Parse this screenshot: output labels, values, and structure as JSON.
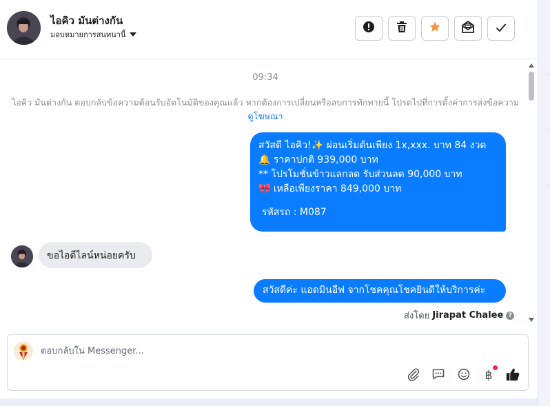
{
  "header": {
    "contact_name": "ไอคิว มันต่างกัน",
    "assign_label": "มอบหมายการสนทนานี้",
    "actions": [
      {
        "name": "report-spam",
        "icon": "alert-circle-icon"
      },
      {
        "name": "delete",
        "icon": "trash-icon"
      },
      {
        "name": "star",
        "icon": "star-icon",
        "color": "#f7923a"
      },
      {
        "name": "mark-unread",
        "icon": "envelope-icon"
      },
      {
        "name": "mark-done",
        "icon": "check-icon"
      }
    ]
  },
  "conversation": {
    "timestamp": "09:34",
    "system_message": "ไอคิว มันต่างกัน ตอบกลับข้อความต้อนรับอัตโนมัติของคุณแล้ว หากต้องการเปลี่ยนหรือลบการทักทายนี้ โปรดไปที่การตั้งค่าการส่งข้อความ",
    "system_link": "ดูโฆษณา",
    "outgoing_1": {
      "lines": [
        "สวัสดี ไอคิว!✨  ผ่อนเริ่มต้นเพียง 1x,xxx. บาท 84 งวด",
        "🔔 ราคาปกติ 939,000 บาท",
        "** โปรโมชั่นข้าวแลกลด รับส่วนลด 90,000 บาท",
        "🎀  เหลือเพียงราคา 849,000 บาท"
      ],
      "code_line": "รหัสรถ : M087"
    },
    "incoming_1": "ขอไอดีไลน์หน่อยครับ",
    "outgoing_2": "สวัสดีค่ะ แอดมินอีฟ จากโชคคุณโชคยินดีให้บริการค่ะ",
    "sent_by_prefix": "ส่งโดย",
    "sent_by_name": "Jirapat Chalee",
    "help_mark": "?"
  },
  "composer": {
    "placeholder": "ตอบกลับใน Messenger...",
    "baht_symbol": "฿",
    "icons": [
      "paperclip-icon",
      "saved-reply-icon",
      "emoji-icon",
      "payment-icon",
      "like-icon"
    ]
  },
  "colors": {
    "accent": "#0a7cff",
    "link": "#1877f2",
    "notification_dot": "#f02849"
  }
}
